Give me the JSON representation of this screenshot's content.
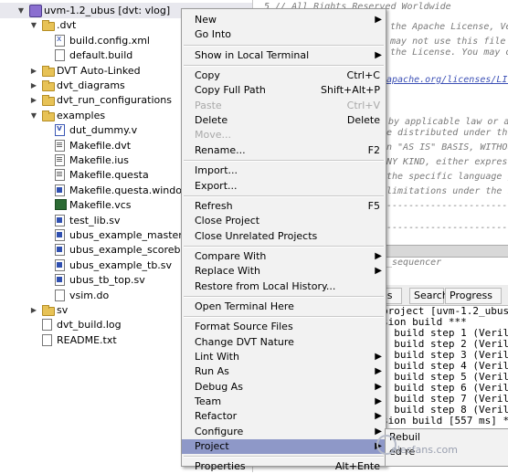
{
  "tree": {
    "rows": [
      {
        "label": "uvm-1.2_ubus [dvt: vlog]",
        "icon": "project-icon",
        "twisty": "▼"
      },
      {
        "label": ".dvt",
        "icon": "folder-icon",
        "twisty": "▼"
      },
      {
        "label": "build.config.xml",
        "icon": "xml-file-icon",
        "twisty": ""
      },
      {
        "label": "default.build",
        "icon": "file-icon",
        "twisty": ""
      },
      {
        "label": "DVT Auto-Linked",
        "icon": "folder-icon",
        "twisty": "▶"
      },
      {
        "label": "dvt_diagrams",
        "icon": "folder-icon",
        "twisty": "▶"
      },
      {
        "label": "dvt_run_configurations",
        "icon": "folder-icon",
        "twisty": "▶"
      },
      {
        "label": "examples",
        "icon": "folder-icon",
        "twisty": "▼"
      },
      {
        "label": "dut_dummy.v",
        "icon": "verilog-file-icon",
        "twisty": ""
      },
      {
        "label": "Makefile.dvt",
        "icon": "makefile-icon",
        "twisty": ""
      },
      {
        "label": "Makefile.ius",
        "icon": "makefile-icon",
        "twisty": ""
      },
      {
        "label": "Makefile.questa",
        "icon": "makefile-icon",
        "twisty": ""
      },
      {
        "label": "Makefile.questa.windows.sh",
        "icon": "script-icon",
        "twisty": ""
      },
      {
        "label": "Makefile.vcs",
        "icon": "terminal-file-icon",
        "twisty": ""
      },
      {
        "label": "test_lib.sv",
        "icon": "sv-file-icon",
        "twisty": ""
      },
      {
        "label": "ubus_example_master_seq_lib.sv",
        "icon": "sv-file-icon",
        "twisty": ""
      },
      {
        "label": "ubus_example_scoreboard.sv",
        "icon": "sv-file-icon",
        "twisty": ""
      },
      {
        "label": "ubus_example_tb.sv",
        "icon": "sv-file-icon",
        "twisty": ""
      },
      {
        "label": "ubus_tb_top.sv",
        "icon": "sv-file-icon",
        "twisty": ""
      },
      {
        "label": "vsim.do",
        "icon": "file-icon",
        "twisty": ""
      },
      {
        "label": "sv",
        "icon": "folder-icon",
        "twisty": "▶"
      },
      {
        "label": "dvt_build.log",
        "icon": "file-icon",
        "twisty": ""
      },
      {
        "label": "README.txt",
        "icon": "file-icon",
        "twisty": ""
      }
    ]
  },
  "editor": {
    "lines": [
      {
        "text": "5 //   All Rights Reserved Worldwide",
        "kind": "comment"
      },
      {
        "text": "the Apache License, Vers",
        "kind": "comment"
      },
      {
        "text": "may not use this file e",
        "kind": "comment"
      },
      {
        "text": "the License.  You may o",
        "kind": "comment"
      },
      {
        "text": "apache.org/licenses/LICE",
        "kind": "link"
      },
      {
        "text": "by applicable law or ag",
        "kind": "comment"
      },
      {
        "text": "e distributed under the",
        "kind": "comment"
      },
      {
        "text": "n \"AS IS\" BASIS, WITHOU",
        "kind": "comment"
      },
      {
        "text": "NY KIND, either express",
        "kind": "comment"
      },
      {
        "text": "the specific language g",
        "kind": "comment"
      },
      {
        "text": "limitations under the L",
        "kind": "comment"
      },
      {
        "text": "--------------------------",
        "kind": "comment"
      },
      {
        "text": "--------------------------",
        "kind": "comment"
      },
      {
        "text": "_sequencer",
        "kind": "comment"
      }
    ]
  },
  "console": {
    "tabs": [
      "os",
      "Search",
      "Progress"
    ],
    "lines": [
      "project [uvm-1.2_ubus]",
      "sion build ***",
      ". build step 1 (Verilog",
      ". build step 2 (Verilog",
      ". build step 3 (Verilog",
      ". build step 4 (Verilog",
      ". build step 5 (Verilog",
      ". build step 6 (Verilog",
      ". build step 7 (Verilog",
      ". build step 8 (Verilog",
      "sion build [557 ms] ***"
    ]
  },
  "menu": {
    "items": [
      {
        "type": "item",
        "label": "New",
        "shortcut": "",
        "submenu": true,
        "disabled": false
      },
      {
        "type": "item",
        "label": "Go Into",
        "shortcut": "",
        "submenu": false,
        "disabled": false
      },
      {
        "type": "sep"
      },
      {
        "type": "item",
        "label": "Show in Local Terminal",
        "shortcut": "",
        "submenu": true,
        "disabled": false
      },
      {
        "type": "sep"
      },
      {
        "type": "item",
        "label": "Copy",
        "shortcut": "Ctrl+C",
        "submenu": false,
        "disabled": false
      },
      {
        "type": "item",
        "label": "Copy Full Path",
        "shortcut": "Shift+Alt+P",
        "submenu": false,
        "disabled": false
      },
      {
        "type": "item",
        "label": "Paste",
        "shortcut": "Ctrl+V",
        "submenu": false,
        "disabled": true
      },
      {
        "type": "item",
        "label": "Delete",
        "shortcut": "Delete",
        "submenu": false,
        "disabled": false
      },
      {
        "type": "item",
        "label": "Move...",
        "shortcut": "",
        "submenu": false,
        "disabled": true
      },
      {
        "type": "item",
        "label": "Rename...",
        "shortcut": "F2",
        "submenu": false,
        "disabled": false
      },
      {
        "type": "sep"
      },
      {
        "type": "item",
        "label": "Import...",
        "shortcut": "",
        "submenu": false,
        "disabled": false
      },
      {
        "type": "item",
        "label": "Export...",
        "shortcut": "",
        "submenu": false,
        "disabled": false
      },
      {
        "type": "sep"
      },
      {
        "type": "item",
        "label": "Refresh",
        "shortcut": "F5",
        "submenu": false,
        "disabled": false
      },
      {
        "type": "item",
        "label": "Close Project",
        "shortcut": "",
        "submenu": false,
        "disabled": false
      },
      {
        "type": "item",
        "label": "Close Unrelated Projects",
        "shortcut": "",
        "submenu": false,
        "disabled": false
      },
      {
        "type": "sep"
      },
      {
        "type": "item",
        "label": "Compare With",
        "shortcut": "",
        "submenu": true,
        "disabled": false
      },
      {
        "type": "item",
        "label": "Replace With",
        "shortcut": "",
        "submenu": true,
        "disabled": false
      },
      {
        "type": "item",
        "label": "Restore from Local History...",
        "shortcut": "",
        "submenu": false,
        "disabled": false
      },
      {
        "type": "sep"
      },
      {
        "type": "item",
        "label": "Open Terminal Here",
        "shortcut": "",
        "submenu": false,
        "disabled": false
      },
      {
        "type": "sep"
      },
      {
        "type": "item",
        "label": "Format Source Files",
        "shortcut": "",
        "submenu": false,
        "disabled": false
      },
      {
        "type": "item",
        "label": "Change DVT Nature",
        "shortcut": "",
        "submenu": false,
        "disabled": false
      },
      {
        "type": "item",
        "label": "Lint With",
        "shortcut": "",
        "submenu": true,
        "disabled": false
      },
      {
        "type": "item",
        "label": "Run As",
        "shortcut": "",
        "submenu": true,
        "disabled": false
      },
      {
        "type": "item",
        "label": "Debug As",
        "shortcut": "",
        "submenu": true,
        "disabled": false
      },
      {
        "type": "item",
        "label": "Team",
        "shortcut": "",
        "submenu": true,
        "disabled": false
      },
      {
        "type": "item",
        "label": "Refactor",
        "shortcut": "",
        "submenu": true,
        "disabled": false
      },
      {
        "type": "item",
        "label": "Configure",
        "shortcut": "",
        "submenu": true,
        "disabled": false
      },
      {
        "type": "item",
        "label": "Project",
        "shortcut": "",
        "submenu": true,
        "disabled": false,
        "active": true
      },
      {
        "type": "sep"
      },
      {
        "type": "item",
        "label": "Properties",
        "shortcut": "Alt+Ente",
        "submenu": false,
        "disabled": false
      }
    ]
  },
  "submenu": {
    "lines": [
      "Rebuil",
      "ed re"
    ]
  },
  "watermark": "elecfans.com"
}
